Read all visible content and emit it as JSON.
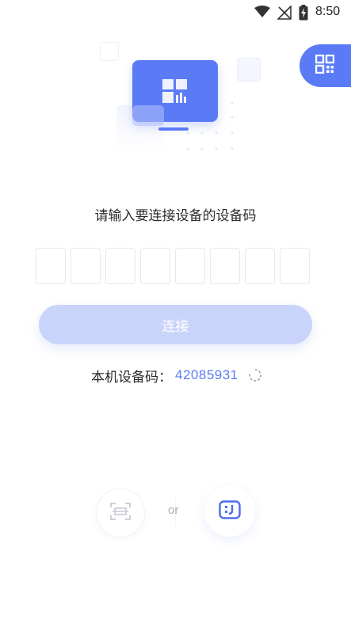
{
  "status_bar": {
    "time": "8:50",
    "icons": [
      "wifi-icon",
      "no-signal-icon",
      "battery-charging-icon"
    ]
  },
  "header": {
    "qr_button_icon": "qr-code-icon"
  },
  "main": {
    "prompt": "请输入要连接设备的设备码",
    "code_boxes": [
      "",
      "",
      "",
      "",
      "",
      "",
      "",
      ""
    ],
    "connect_label": "连接",
    "local_code_label": "本机设备码：",
    "local_code_value": "42085931",
    "refresh_icon": "refresh-icon"
  },
  "bottom": {
    "scan_icon": "scan-icon",
    "or_label": "or",
    "face_icon": "face-code-icon"
  },
  "colors": {
    "accent": "#5b7bf6",
    "button_disabled": "#c9d4fb",
    "box_border": "#e4e8f2"
  }
}
